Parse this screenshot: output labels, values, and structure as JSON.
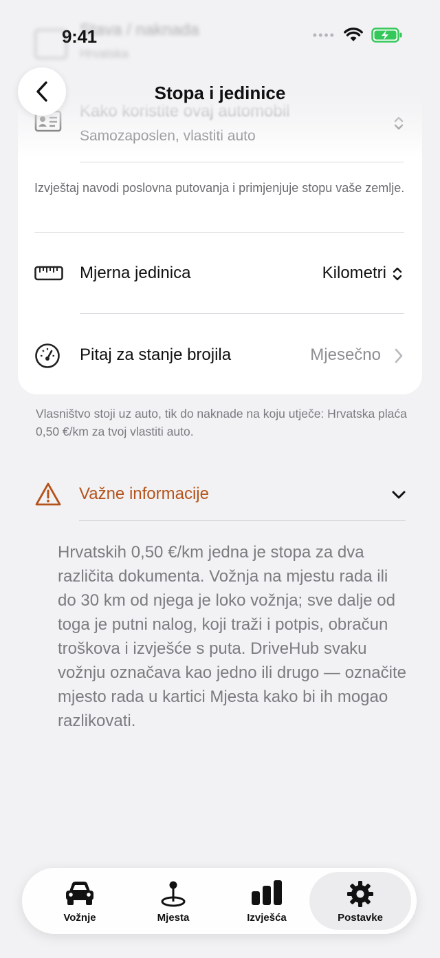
{
  "status_bar": {
    "time": "9:41"
  },
  "ghost_header": {
    "title": "Stava / naknada",
    "subtitle": "Hrvatska"
  },
  "nav": {
    "title": "Stopa i jedinice",
    "back_label": "‹"
  },
  "usage": {
    "label": "Kako koristite ovaj automobil",
    "value": "Samozaposlen, vlastiti auto",
    "note": "Izvještaj navodi poslovna putovanja i primjenjuje stopu vaše zemlje."
  },
  "unit": {
    "label": "Mjerna jedinica",
    "value": "Kilometri"
  },
  "odometer": {
    "label": "Pitaj za stanje brojila",
    "value": "Mjesečno"
  },
  "footnote": "Vlasništvo stoji uz auto, tik do naknade na koju utječe: Hrvatska plaća 0,50 €/km za tvoj vlastiti auto.",
  "important": {
    "label": "Važne informacije",
    "body": "Hrvatskih 0,50 €/km jedna je stopa za dva različita dokumenta. Vožnja na mjestu rada ili do 30 km od njega je loko vožnja; sve dalje od toga je putni nalog, koji traži i potpis, obračun troškova i izvješće s puta. DriveHub svaku vožnju označava kao jedno ili drugo — označite mjesto rada u kartici Mjesta kako bi ih mogao razlikovati."
  },
  "tabs": [
    {
      "label": "Vožnje",
      "icon": "car-icon"
    },
    {
      "label": "Mjesta",
      "icon": "map-pin-icon"
    },
    {
      "label": "Izvješća",
      "icon": "bar-chart-icon"
    },
    {
      "label": "Postavke",
      "icon": "gear-icon",
      "active": true
    }
  ],
  "colors": {
    "accent_warning": "#b4531a",
    "battery": "#34c759",
    "background": "#f2f2f4"
  }
}
